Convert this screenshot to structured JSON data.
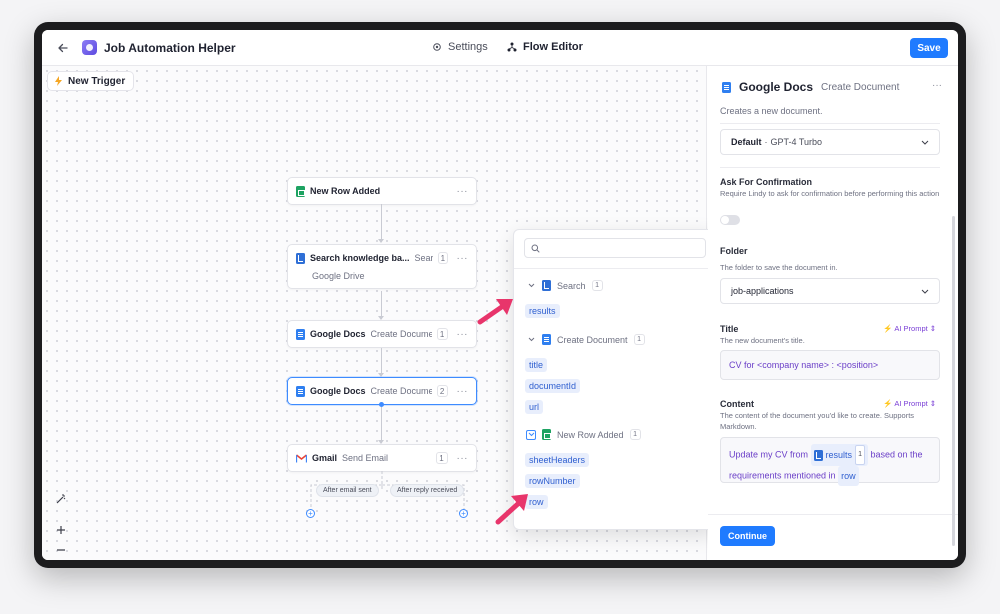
{
  "app": {
    "title": "Job Automation Helper",
    "nav": {
      "settings": "Settings",
      "flow_editor": "Flow Editor"
    },
    "save_label": "Save"
  },
  "canvas": {
    "trigger_button": "New Trigger",
    "nodes": [
      {
        "title": "New Row Added",
        "subtitle": "",
        "count": "",
        "icon": "sheets-icon"
      },
      {
        "title": "Search knowledge ba...",
        "subtitle": "Sear...",
        "count": "1",
        "detail": "Google Drive",
        "icon": "knowledge-base-icon"
      },
      {
        "title": "Google Docs",
        "subtitle": "Create Document",
        "count": "1",
        "icon": "docs-icon"
      },
      {
        "title": "Google Docs",
        "subtitle": "Create Document",
        "count": "2",
        "icon": "docs-icon"
      },
      {
        "title": "Gmail",
        "subtitle": "Send Email",
        "count": "1",
        "icon": "gmail-icon"
      }
    ],
    "branches": {
      "left": "After email sent",
      "right": "After reply received"
    },
    "more": "···"
  },
  "variables": {
    "search_placeholder": "",
    "groups": [
      {
        "label": "Search",
        "count": "1",
        "items": [
          "results"
        ]
      },
      {
        "label": "Create Document",
        "count": "1",
        "items": [
          "title",
          "documentId",
          "url"
        ]
      },
      {
        "label": "New Row Added",
        "count": "1",
        "items": [
          "sheetHeaders",
          "rowNumber",
          "row"
        ]
      }
    ],
    "accent_arrow": "#e8356b"
  },
  "panel": {
    "title": "Google Docs",
    "subtitle": "Create Document",
    "description": "Creates a new document.",
    "model_prefix": "Default",
    "model_sep": "·",
    "model_name": "GPT-4 Turbo",
    "confirm_label": "Ask For Confirmation",
    "confirm_help": "Require Lindy to ask for confirmation before performing this action",
    "folder_label": "Folder",
    "folder_help": "The folder to save the document in.",
    "folder_value": "job-applications",
    "title_label": "Title",
    "title_help": "The new document's title.",
    "title_value": "CV for <company name> : <position>",
    "content_label": "Content",
    "content_help": "The content of the document you'd like to create. Supports Markdown.",
    "content_part1": "Update my CV from",
    "content_chip": "results",
    "content_chip_count": "1",
    "content_part2": "based on",
    "content_part3": "the requirements mentioned in",
    "content_chip2": "row",
    "ai_prompt_label": "AI Prompt",
    "continue_label": "Continue"
  },
  "colors": {
    "accent": "#1f7bff",
    "purple": "#7a3fd6"
  }
}
